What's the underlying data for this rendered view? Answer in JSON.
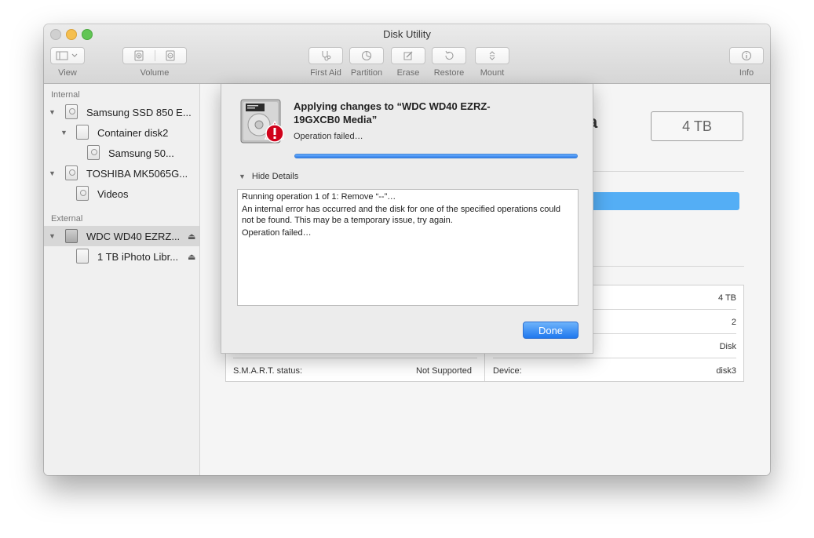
{
  "window": {
    "title": "Disk Utility"
  },
  "toolbar": {
    "view_label": "View",
    "volume_label": "Volume",
    "first_aid_label": "First Aid",
    "partition_label": "Partition",
    "erase_label": "Erase",
    "restore_label": "Restore",
    "mount_label": "Mount",
    "info_label": "Info"
  },
  "sidebar": {
    "internal_header": "Internal",
    "external_header": "External",
    "internal_items": [
      {
        "label": "Samsung SSD 850 E..."
      },
      {
        "label": "Container disk2"
      },
      {
        "label": "Samsung 50..."
      },
      {
        "label": "TOSHIBA MK5065G..."
      },
      {
        "label": "Videos"
      }
    ],
    "external_items": [
      {
        "label": "WDC WD40 EZRZ...",
        "selected": true
      },
      {
        "label": "1 TB iPhoto Libr..."
      }
    ]
  },
  "main": {
    "capacity_box": "4 TB",
    "title_fragment": "a",
    "info_rows": {
      "r1_right": "4 TB",
      "r2_right": "2",
      "r3_right": "Disk",
      "smart_label": "S.M.A.R.T. status:",
      "smart_value": "Not Supported",
      "device_label": "Device:",
      "device_value": "disk3"
    }
  },
  "dialog": {
    "title": "Applying changes to “WDC WD40 EZRZ-19GXCB0 Media”",
    "status": "Operation failed…",
    "progress_fraction": 1.0,
    "details_toggle": "Hide Details",
    "details_lines": [
      "Running operation 1 of 1: Remove “--”…",
      "An internal error has occurred and the disk for one of the specified operations could not be found. This may be a temporary issue, try again.",
      "Operation failed…"
    ],
    "done_label": "Done"
  },
  "colors": {
    "accent": "#2f7de8",
    "selection": "#d7d7d7",
    "error_badge": "#d0021b"
  }
}
